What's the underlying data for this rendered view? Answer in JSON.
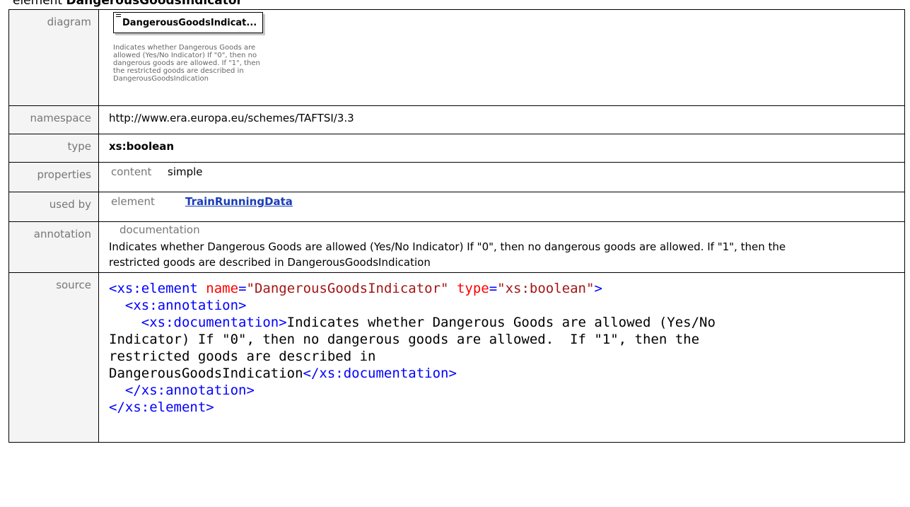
{
  "heading": {
    "prefix": "element ",
    "name": "DangerousGoodsIndicator"
  },
  "labels": {
    "diagram": "diagram",
    "namespace": "namespace",
    "type": "type",
    "properties": "properties",
    "used_by": "used by",
    "annotation": "annotation",
    "source": "source"
  },
  "diagram": {
    "box_name": "DangerousGoodsIndicat...",
    "doc": "Indicates whether Dangerous Goods are allowed (Yes/No Indicator) If \"0\", then no dangerous goods are allowed.  If \"1\", then the restricted goods are described in DangerousGoodsIndication"
  },
  "namespace": "http://www.era.europa.eu/schemes/TAFTSI/3.3",
  "type": "xs:boolean",
  "properties": {
    "label": "content",
    "value": "simple"
  },
  "used_by": {
    "label": "element",
    "link": "TrainRunningData"
  },
  "annotation": {
    "title": "documentation",
    "text": "Indicates whether Dangerous Goods are allowed (Yes/No Indicator) If \"0\", then no dangerous goods are allowed.  If \"1\", then the restricted goods are described in DangerousGoodsIndication"
  },
  "source": {
    "open_tag": "<xs:element",
    "name_attr": "name",
    "name_val": "\"DangerousGoodsIndicator\"",
    "type_attr": "type",
    "type_val": "\"xs:boolean\"",
    "gt": ">",
    "eq": "=",
    "annotation_open": "<xs:annotation>",
    "doc_open": "<xs:documentation>",
    "doc_text_1": "Indicates whether Dangerous Goods are allowed (Yes/No",
    "doc_text_2": "Indicator) If \"0\", then no dangerous goods are allowed.  If \"1\", then the",
    "doc_text_3": "restricted goods are described in",
    "doc_text_4": "DangerousGoodsIndication",
    "doc_close": "</xs:documentation>",
    "annotation_close": "</xs:annotation>",
    "element_close": "</xs:element>"
  }
}
